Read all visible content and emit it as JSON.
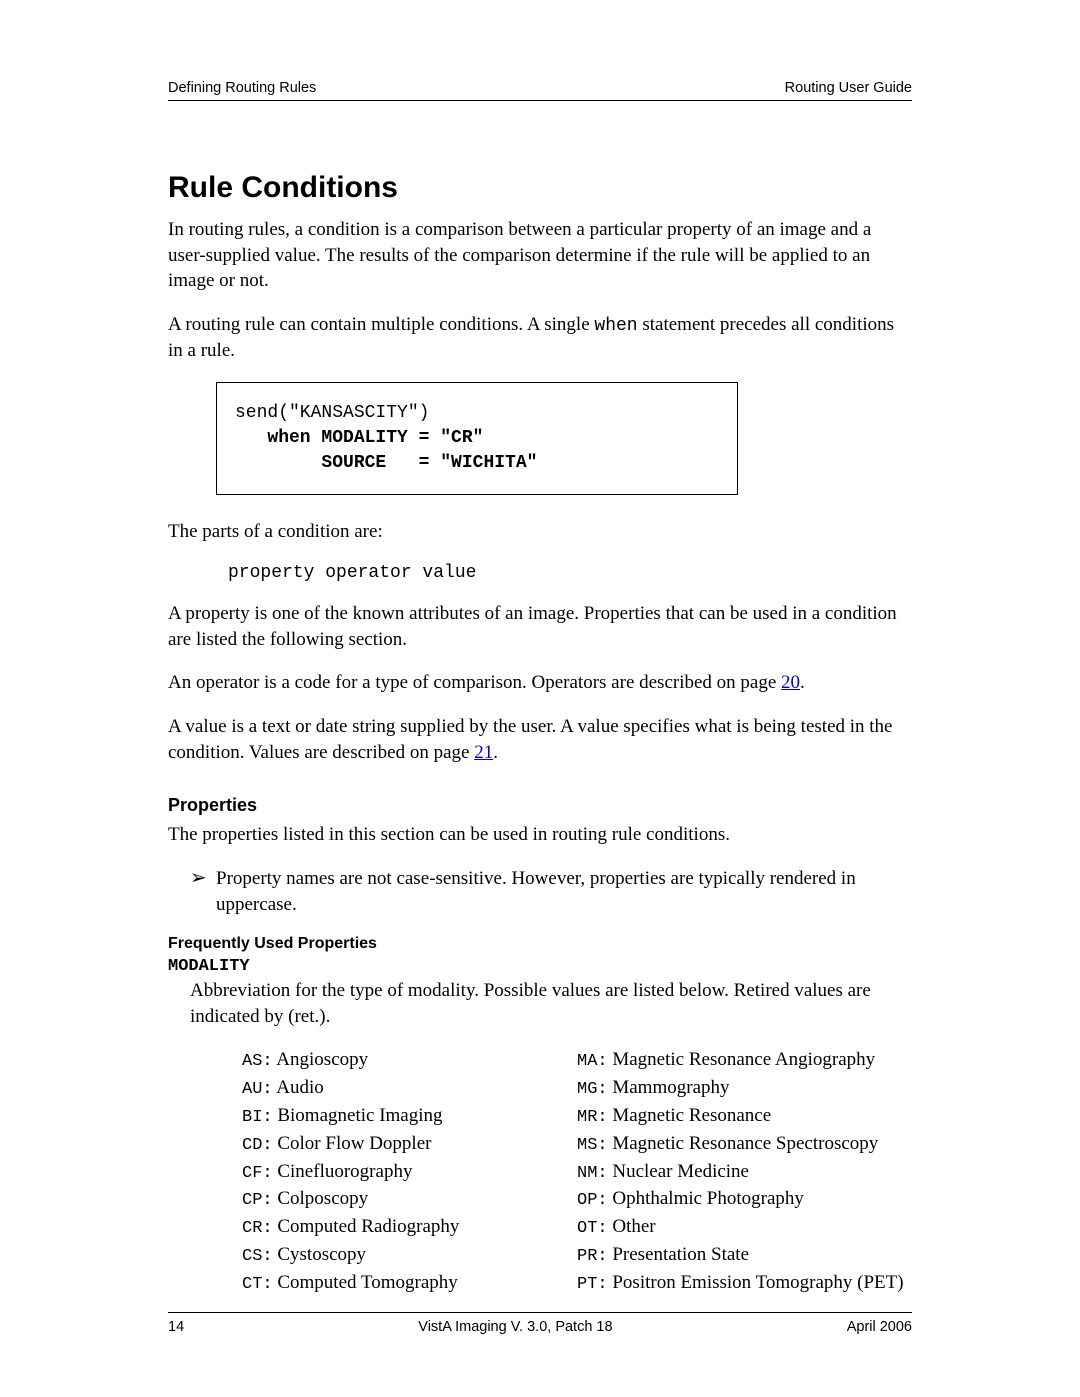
{
  "header": {
    "left": "Defining Routing Rules",
    "right": "Routing User Guide"
  },
  "h1": "Rule Conditions",
  "p1": "In routing rules, a condition is a comparison between a particular property of an image and a user-supplied value. The results of the comparison determine if the rule will be applied to an image or not.",
  "p2a": "A routing rule can contain multiple conditions. A single ",
  "p2_code": "when",
  "p2b": " statement precedes all conditions in a rule.",
  "codebox": {
    "line1": "send(\"KANSASCITY\")",
    "line2": "   when MODALITY = \"CR\"",
    "line3": "        SOURCE   = \"WICHITA\""
  },
  "p3": "The parts of a condition are:",
  "code_inline": "property operator value",
  "p4": "A property is one of the known attributes of an image. Properties that can be used in a condition are listed the following section.",
  "p5a": "An operator is a code for a type of comparison. Operators are described on page ",
  "link1": "20",
  "p5b": ".",
  "p6a": "A value is a text or date string supplied by the user. A value specifies what is being tested in the condition. Values are described on page ",
  "link2": "21",
  "p6b": ".",
  "h2_properties": "Properties",
  "p7": "The properties listed in this section can be used in routing rule conditions.",
  "note_icon": "➢",
  "note": "Property names are not case-sensitive. However, properties are typically rendered in uppercase.",
  "h3_freq": "Frequently Used Properties",
  "prop_modality": "MODALITY",
  "p8": "Abbreviation for the type of modality. Possible values are listed below.  Retired values are indicated by (ret.).",
  "modalities_left": [
    {
      "code": "AS",
      "label": "Angioscopy"
    },
    {
      "code": "AU",
      "label": "Audio"
    },
    {
      "code": "BI",
      "label": "Biomagnetic Imaging"
    },
    {
      "code": "CD",
      "label": "Color Flow Doppler"
    },
    {
      "code": "CF",
      "label": "Cinefluorography"
    },
    {
      "code": "CP",
      "label": "Colposcopy"
    },
    {
      "code": "CR",
      "label": "Computed Radiography"
    },
    {
      "code": "CS",
      "label": "Cystoscopy"
    },
    {
      "code": "CT",
      "label": "Computed Tomography"
    }
  ],
  "modalities_right": [
    {
      "code": "MA",
      "label": "Magnetic Resonance Angiography"
    },
    {
      "code": "MG",
      "label": "Mammography"
    },
    {
      "code": "MR",
      "label": "Magnetic Resonance"
    },
    {
      "code": "MS",
      "label": "Magnetic Resonance Spectroscopy"
    },
    {
      "code": "NM",
      "label": "Nuclear Medicine"
    },
    {
      "code": "OP",
      "label": "Ophthalmic Photography"
    },
    {
      "code": "OT",
      "label": "Other"
    },
    {
      "code": "PR",
      "label": "Presentation State"
    },
    {
      "code": "PT",
      "label": "Positron Emission Tomography (PET)"
    }
  ],
  "footer": {
    "left": "14",
    "center": "VistA Imaging V. 3.0, Patch 18",
    "right": "April 2006"
  }
}
